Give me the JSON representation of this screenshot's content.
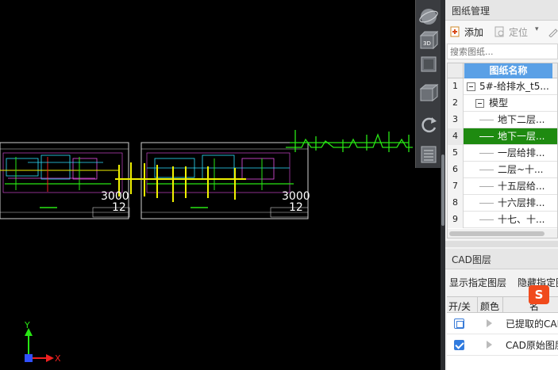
{
  "canvas": {
    "dimension_labels": [
      "3000",
      "12",
      "3000",
      "12"
    ],
    "axis": {
      "x_label": "X",
      "y_label": "Y"
    }
  },
  "view_tools": {
    "icons": [
      "globe-icon",
      "view-3d-icon",
      "view-front-icon",
      "view-iso-icon",
      "rotate-icon",
      "layers-stack-icon"
    ],
    "view_3d_text": "3D"
  },
  "drawing_panel": {
    "title": "图纸管理",
    "add_label": "添加",
    "locate_label": "定位",
    "search_placeholder": "搜索图纸...",
    "column_name": "图纸名称",
    "rows": [
      {
        "num": "1",
        "name": "5#-给排水_t5..."
      },
      {
        "num": "2",
        "name": "模型"
      },
      {
        "num": "3",
        "name": "地下二层..."
      },
      {
        "num": "4",
        "name": "地下一层..."
      },
      {
        "num": "5",
        "name": "一层给排..."
      },
      {
        "num": "6",
        "name": "二层~十..."
      },
      {
        "num": "7",
        "name": "十五层给..."
      },
      {
        "num": "8",
        "name": "十六层排..."
      },
      {
        "num": "9",
        "name": "十七、十..."
      }
    ],
    "selected_row": "4"
  },
  "cad_panel": {
    "title": "CAD图层",
    "show_label": "显示指定图层",
    "hide_label": "隐藏指定图",
    "col_onoff": "开/关",
    "col_color": "颜色",
    "col_name": "名",
    "layers": [
      {
        "name": "已提取的CAD",
        "checked": false
      },
      {
        "name": "CAD原始图层",
        "checked": true
      }
    ],
    "ime_badge": "S"
  },
  "colors": {
    "selected_row": "#1e8a10",
    "header_blue": "#5aa0e6",
    "cad_green": "#28e614",
    "cad_yellow": "#f0f000"
  }
}
